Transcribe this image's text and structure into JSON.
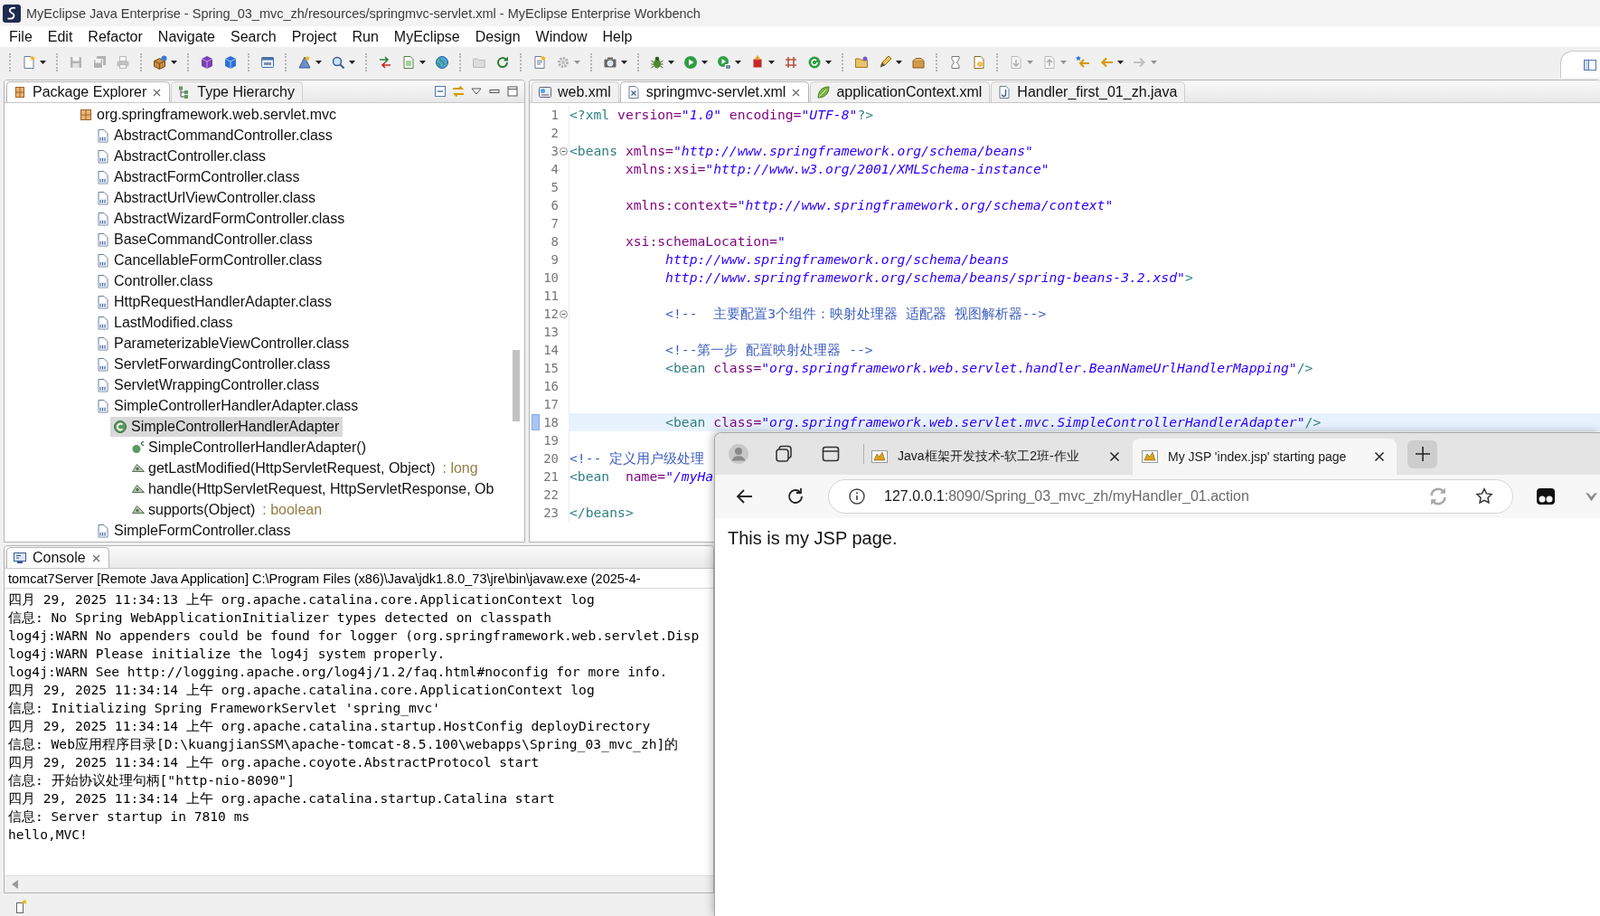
{
  "window": {
    "title": "MyEclipse Java Enterprise - Spring_03_mvc_zh/resources/springmvc-servlet.xml - MyEclipse Enterprise Workbench"
  },
  "menu": [
    "File",
    "Edit",
    "Refactor",
    "Navigate",
    "Search",
    "Project",
    "Run",
    "MyEclipse",
    "Design",
    "Window",
    "Help"
  ],
  "toolbar": [
    [
      {
        "disabled": false,
        "dropdown": true
      }
    ],
    [
      {
        "disabled": true,
        "dropdown": false
      },
      {
        "disabled": true,
        "dropdown": false
      },
      {
        "disabled": true,
        "dropdown": false
      }
    ],
    [
      {
        "disabled": false,
        "dropdown": true
      }
    ],
    [
      {
        "disabled": false,
        "dropdown": false
      },
      {
        "disabled": false,
        "dropdown": false
      }
    ],
    [
      {
        "disabled": false,
        "dropdown": false
      }
    ],
    [
      {
        "disabled": false,
        "dropdown": true
      },
      {
        "disabled": false,
        "dropdown": true
      }
    ],
    [
      {
        "disabled": false,
        "dropdown": false
      },
      {
        "disabled": false,
        "dropdown": true
      },
      {
        "disabled": false,
        "dropdown": false
      }
    ],
    [
      {
        "disabled": true,
        "dropdown": false
      },
      {
        "disabled": false,
        "dropdown": false
      }
    ],
    [
      {
        "disabled": false,
        "dropdown": false
      },
      {
        "disabled": true,
        "dropdown": true
      }
    ],
    [
      {
        "disabled": false,
        "dropdown": true
      }
    ],
    [
      {
        "disabled": false,
        "dropdown": true
      },
      {
        "disabled": false,
        "dropdown": true
      },
      {
        "disabled": false,
        "dropdown": true
      },
      {
        "disabled": false,
        "dropdown": true
      },
      {
        "disabled": false,
        "dropdown": false
      },
      {
        "disabled": false,
        "dropdown": true
      }
    ],
    [
      {
        "disabled": false,
        "dropdown": false
      },
      {
        "disabled": false,
        "dropdown": true
      },
      {
        "disabled": false,
        "dropdown": false
      }
    ],
    [
      {
        "disabled": false,
        "dropdown": false
      },
      {
        "disabled": false,
        "dropdown": false
      }
    ],
    [
      {
        "disabled": true,
        "dropdown": true
      },
      {
        "disabled": true,
        "dropdown": true
      },
      {
        "disabled": false,
        "dropdown": false
      },
      {
        "disabled": false,
        "dropdown": true
      },
      {
        "disabled": true,
        "dropdown": true
      }
    ]
  ],
  "package_explorer": {
    "tabs": [
      {
        "label": "Package Explorer",
        "selected": true
      },
      {
        "label": "Type Hierarchy",
        "selected": false
      }
    ],
    "tree": [
      {
        "label": "org.springframework.web.servlet.mvc",
        "kind": "package",
        "selected": false,
        "children": [
          {
            "label": "AbstractCommandController.class",
            "kind": "classfile",
            "selected": false
          },
          {
            "label": "AbstractController.class",
            "kind": "classfile",
            "selected": false
          },
          {
            "label": "AbstractFormController.class",
            "kind": "classfile",
            "selected": false
          },
          {
            "label": "AbstractUrlViewController.class",
            "kind": "classfile",
            "selected": false
          },
          {
            "label": "AbstractWizardFormController.class",
            "kind": "classfile",
            "selected": false
          },
          {
            "label": "BaseCommandController.class",
            "kind": "classfile",
            "selected": false
          },
          {
            "label": "CancellableFormController.class",
            "kind": "classfile",
            "selected": false
          },
          {
            "label": "Controller.class",
            "kind": "classfile",
            "selected": false
          },
          {
            "label": "HttpRequestHandlerAdapter.class",
            "kind": "classfile",
            "selected": false
          },
          {
            "label": "LastModified.class",
            "kind": "classfile",
            "selected": false
          },
          {
            "label": "ParameterizableViewController.class",
            "kind": "classfile",
            "selected": false
          },
          {
            "label": "ServletForwardingController.class",
            "kind": "classfile",
            "selected": false
          },
          {
            "label": "ServletWrappingController.class",
            "kind": "classfile",
            "selected": false
          },
          {
            "label": "SimpleControllerHandlerAdapter.class",
            "kind": "classfile",
            "selected": false,
            "children": [
              {
                "label": "SimpleControllerHandlerAdapter",
                "kind": "class",
                "selected": true,
                "children": [
                  {
                    "label": "SimpleControllerHandlerAdapter()",
                    "kind": "constructor",
                    "selected": false
                  },
                  {
                    "label": "getLastModified(HttpServletRequest, Object)",
                    "kind": "method",
                    "selected": false,
                    "return_type": ": long"
                  },
                  {
                    "label": "handle(HttpServletRequest, HttpServletResponse, Ob",
                    "kind": "method",
                    "selected": false
                  },
                  {
                    "label": "supports(Object)",
                    "kind": "method",
                    "selected": false,
                    "return_type": ": boolean"
                  }
                ]
              }
            ]
          },
          {
            "label": "SimpleFormController.class",
            "kind": "classfile",
            "selected": false
          }
        ]
      }
    ]
  },
  "editor": {
    "tabs": [
      {
        "label": "web.xml",
        "kind": "webxml",
        "selected": false
      },
      {
        "label": "springmvc-servlet.xml",
        "kind": "xml",
        "selected": true
      },
      {
        "label": "applicationContext.xml",
        "kind": "spring",
        "selected": false
      },
      {
        "label": "Handler_first_01_zh.java",
        "kind": "java",
        "selected": false
      }
    ],
    "lines": [
      {
        "number": "1",
        "kind": "top",
        "fold": false,
        "current": false,
        "tokens": [
          {
            "kind": "tag",
            "text": "<?xml"
          },
          {
            "kind": "attr",
            "text": " version="
          },
          {
            "kind": "value",
            "text": "\"1.0\""
          },
          {
            "kind": "attr",
            "text": " encoding="
          },
          {
            "kind": "value",
            "text": "\"UTF-8\""
          },
          {
            "kind": "tag",
            "text": "?>"
          }
        ]
      },
      {
        "number": "2",
        "kind": "blank",
        "fold": false,
        "current": false
      },
      {
        "number": "3",
        "kind": "top",
        "fold": true,
        "current": false,
        "tokens": [
          {
            "kind": "tag",
            "text": "<beans"
          },
          {
            "kind": "attr",
            "text": " xmlns="
          },
          {
            "kind": "value",
            "text": "\"http://www.springframework.org/schema/beans\""
          }
        ]
      },
      {
        "number": "4",
        "kind": "attribute",
        "fold": false,
        "current": false,
        "tokens": [
          {
            "kind": "attr",
            "text": "xmlns:xsi="
          },
          {
            "kind": "value",
            "text": "\"http://www.w3.org/2001/XMLSchema-instance\""
          }
        ]
      },
      {
        "number": "5",
        "kind": "blank",
        "fold": false,
        "current": false
      },
      {
        "number": "6",
        "kind": "attribute",
        "fold": false,
        "current": false,
        "tokens": [
          {
            "kind": "attr",
            "text": "xmlns:context="
          },
          {
            "kind": "value",
            "text": "\"http://www.springframework.org/schema/context\""
          }
        ]
      },
      {
        "number": "7",
        "kind": "blank",
        "fold": false,
        "current": false
      },
      {
        "number": "8",
        "kind": "attribute",
        "fold": false,
        "current": false,
        "tokens": [
          {
            "kind": "attr",
            "text": "xsi:schemaLocation="
          },
          {
            "kind": "value",
            "text": "\""
          }
        ]
      },
      {
        "number": "9",
        "kind": "child",
        "fold": false,
        "current": false,
        "tokens": [
          {
            "kind": "value",
            "text": "http://www.springframework.org/schema/beans"
          }
        ]
      },
      {
        "number": "10",
        "kind": "child",
        "fold": false,
        "current": false,
        "tokens": [
          {
            "kind": "value",
            "text": "http://www.springframework.org/schema/beans/spring-beans-3.2.xsd\""
          },
          {
            "kind": "tag",
            "text": ">"
          }
        ]
      },
      {
        "number": "11",
        "kind": "blank",
        "fold": false,
        "current": false
      },
      {
        "number": "12",
        "kind": "child",
        "fold": true,
        "current": false,
        "tokens": [
          {
            "kind": "comment",
            "text": "<!--  主要配置3个组件：映射处理器 适配器 视图解析器-->"
          }
        ]
      },
      {
        "number": "13",
        "kind": "blank",
        "fold": false,
        "current": false
      },
      {
        "number": "14",
        "kind": "child",
        "fold": false,
        "current": false,
        "tokens": [
          {
            "kind": "comment",
            "text": "<!--第一步 配置映射处理器 -->"
          }
        ]
      },
      {
        "number": "15",
        "kind": "child",
        "fold": false,
        "current": false,
        "tokens": [
          {
            "kind": "tag",
            "text": "<bean"
          },
          {
            "kind": "attr",
            "text": " class="
          },
          {
            "kind": "value",
            "text": "\"org.springframework.web.servlet.handler.BeanNameUrlHandlerMapping\""
          },
          {
            "kind": "tag",
            "text": "/>"
          }
        ]
      },
      {
        "number": "16",
        "kind": "blank",
        "fold": false,
        "current": false
      },
      {
        "number": "17",
        "kind": "blank",
        "fold": false,
        "current": false
      },
      {
        "number": "18",
        "kind": "child",
        "fold": false,
        "current": true,
        "tokens": [
          {
            "kind": "tag",
            "text": "<bean"
          },
          {
            "kind": "attr",
            "text": " class="
          },
          {
            "kind": "value",
            "text": "\"org.springframework.web.servlet.mvc.SimpleControllerHandlerAdapter\""
          },
          {
            "kind": "tag",
            "text": "/>"
          }
        ]
      },
      {
        "number": "19",
        "kind": "blank",
        "fold": false,
        "current": false
      },
      {
        "number": "20",
        "kind": "top",
        "fold": false,
        "current": false,
        "tokens": [
          {
            "kind": "comment",
            "text": "<!-- 定义用户级处理"
          }
        ]
      },
      {
        "number": "21",
        "kind": "top",
        "fold": false,
        "current": false,
        "tokens": [
          {
            "kind": "tag",
            "text": "<bean"
          },
          {
            "kind": "attr",
            "text": "  name="
          },
          {
            "kind": "value",
            "text": "\"/myHa"
          }
        ]
      },
      {
        "number": "22",
        "kind": "blank",
        "fold": false,
        "current": false
      },
      {
        "number": "23",
        "kind": "top",
        "fold": false,
        "current": false,
        "tokens": [
          {
            "kind": "tag",
            "text": "</beans>"
          }
        ]
      }
    ]
  },
  "console": {
    "tabs": [
      {
        "label": "Console",
        "selected": true
      }
    ],
    "process": "tomcat7Server [Remote Java Application] C:\\Program Files (x86)\\Java\\jdk1.8.0_73\\jre\\bin\\javaw.exe (2025-4-",
    "lines": [
      "四月 29, 2025 11:34:13 上午 org.apache.catalina.core.ApplicationContext log",
      "信息: No Spring WebApplicationInitializer types detected on classpath",
      "log4j:WARN No appenders could be found for logger (org.springframework.web.servlet.Disp",
      "log4j:WARN Please initialize the log4j system properly.",
      "log4j:WARN See http://logging.apache.org/log4j/1.2/faq.html#noconfig for more info.",
      "四月 29, 2025 11:34:14 上午 org.apache.catalina.core.ApplicationContext log",
      "信息: Initializing Spring FrameworkServlet 'spring_mvc'",
      "四月 29, 2025 11:34:14 上午 org.apache.catalina.startup.HostConfig deployDirectory",
      "信息: Web应用程序目录[D:\\kuangjianSSM\\apache-tomcat-8.5.100\\webapps\\Spring_03_mvc_zh]的",
      "四月 29, 2025 11:34:14 上午 org.apache.coyote.AbstractProtocol start",
      "信息: 开始协议处理句柄[\"http-nio-8090\"]",
      "四月 29, 2025 11:34:14 上午 org.apache.catalina.startup.Catalina start",
      "信息: Server startup in 7810 ms",
      "hello,MVC!"
    ]
  },
  "browser": {
    "tabs": [
      {
        "title": "Java框架开发技术-软工2班-作业",
        "selected": false
      },
      {
        "title": "My JSP 'index.jsp' starting page",
        "selected": true
      }
    ],
    "address": {
      "host": "127.0.0.1",
      "path": ":8090/Spring_03_mvc_zh/myHandler_01.action"
    },
    "page": {
      "text": "This is my JSP page."
    }
  }
}
